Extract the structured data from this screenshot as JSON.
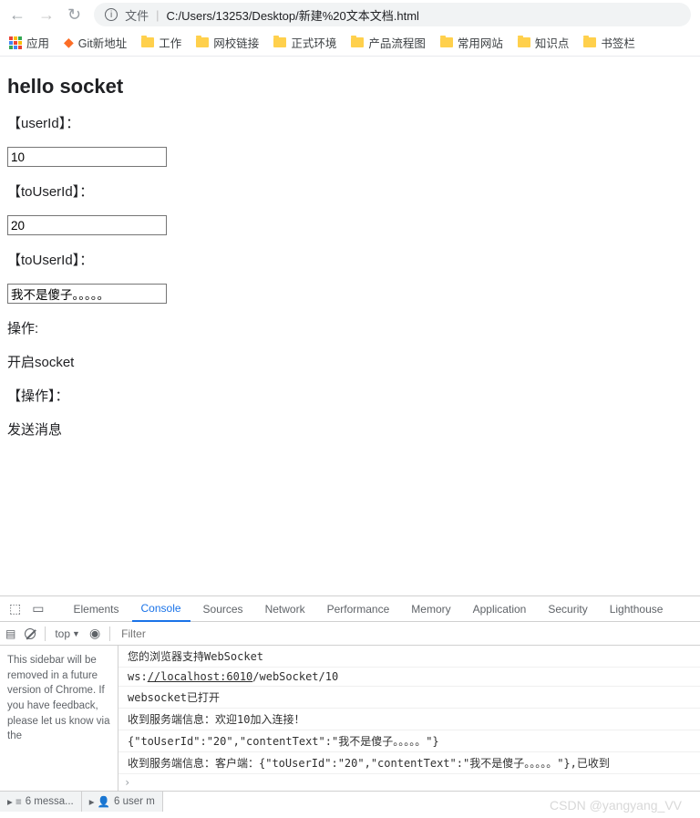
{
  "browser": {
    "address_label": "文件",
    "address_path": "C:/Users/13253/Desktop/新建%20文本文档.html",
    "bookmarks": {
      "apps": "应用",
      "gitlab": "Git新地址",
      "items": [
        "工作",
        "网校链接",
        "正式环境",
        "产品流程图",
        "常用网站",
        "知识点",
        "书签栏"
      ]
    }
  },
  "page": {
    "title": "hello socket",
    "labels": {
      "userId": "【userId】：",
      "toUserId": "【toUserId】：",
      "toUserId2": "【toUserId】：",
      "action1": "操作:",
      "openSocket": "开启socket",
      "action2": "【操作】：",
      "sendMsg": "发送消息"
    },
    "values": {
      "userId": "10",
      "toUserId": "20",
      "content": "我不是傻子。。。。。"
    }
  },
  "devtools": {
    "tabs": [
      "Elements",
      "Console",
      "Sources",
      "Network",
      "Performance",
      "Memory",
      "Application",
      "Security",
      "Lighthouse"
    ],
    "active_tab": "Console",
    "filter": {
      "top": "top",
      "placeholder": "Filter"
    },
    "sidebar_note": "This sidebar will be removed in a future version of Chrome. If you have feedback, please let us know via the",
    "logs": [
      "您的浏览器支持WebSocket",
      "ws://localhost:6010/webSocket/10",
      "websocket已打开",
      "收到服务端信息：欢迎10加入连接！",
      "{\"toUserId\":\"20\",\"contentText\":\"我不是傻子。。。。。\"}",
      "收到服务端信息：客户端：{\"toUserId\":\"20\",\"contentText\":\"我不是傻子。。。。。\"},已收到"
    ],
    "bottom": {
      "messages": "6 messa...",
      "user": "6 user m"
    }
  },
  "watermark": "CSDN @yangyang_VV"
}
